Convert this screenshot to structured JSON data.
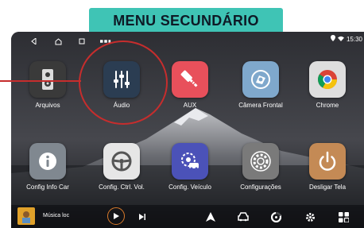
{
  "header": {
    "title": "MENU SECUNDÁRIO"
  },
  "statusbar": {
    "time": "15:30"
  },
  "apps": [
    {
      "label": "Arquivos",
      "icon": "files-icon",
      "bg": "#3a3a3a"
    },
    {
      "label": "Áudio",
      "icon": "equalizer-icon",
      "bg": "#2b3d52"
    },
    {
      "label": "AUX",
      "icon": "aux-cable-icon",
      "bg": "#e8505b"
    },
    {
      "label": "Câmera Frontal",
      "icon": "front-camera-icon",
      "bg": "#7fa8cc"
    },
    {
      "label": "Chrome",
      "icon": "chrome-icon",
      "bg": "#dedede"
    },
    {
      "label": "Config Info Car",
      "icon": "info-icon",
      "bg": "#808890"
    },
    {
      "label": "Config. Ctrl. Vol.",
      "icon": "steering-wheel-icon",
      "bg": "#e6e6e6"
    },
    {
      "label": "Config. Veículo",
      "icon": "vehicle-settings-icon",
      "bg": "#4b52b8"
    },
    {
      "label": "Configurações",
      "icon": "settings-gear-icon",
      "bg": "#7a7a7a"
    },
    {
      "label": "Desligar Tela",
      "icon": "power-icon",
      "bg": "#c48a55"
    }
  ],
  "dock": {
    "media_title": "Música loc",
    "items": [
      "play-icon",
      "next-icon",
      "navigation-icon",
      "car-icon",
      "music-disc-icon",
      "gear-icon",
      "apps-grid-icon"
    ]
  },
  "colors": {
    "accent": "#3fc4b5",
    "callout": "#c62d2d"
  }
}
